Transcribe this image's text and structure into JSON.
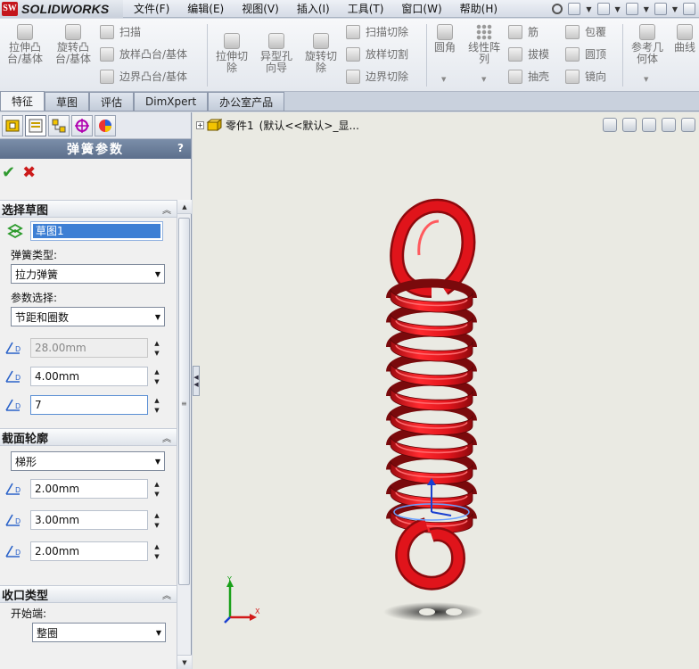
{
  "app": {
    "logo_mark": "SW",
    "logo_text": "SOLIDWORKS"
  },
  "menu": {
    "items": [
      "文件(F)",
      "编辑(E)",
      "视图(V)",
      "插入(I)",
      "工具(T)",
      "窗口(W)",
      "帮助(H)"
    ]
  },
  "command_manager": {
    "extrude_boss": "拉伸凸\n台/基体",
    "revolve_boss": "旋转凸\n台/基体",
    "sweep": "扫描",
    "loft_boss": "放样凸台/基体",
    "boundary_boss": "边界凸台/基体",
    "extrude_cut": "拉伸切\n除",
    "hole_wizard": "异型孔\n向导",
    "revolve_cut": "旋转切\n除",
    "swept_cut": "扫描切除",
    "lofted_cut": "放样切割",
    "boundary_cut": "边界切除",
    "fillet": "圆角",
    "linear_pattern": "线性阵\n列",
    "rib": "筋",
    "draft": "拔模",
    "shell": "抽壳",
    "wrap": "包覆",
    "dome": "圆顶",
    "mirror": "镜向",
    "ref_geometry": "参考几\n何体",
    "curves": "曲线"
  },
  "tabs": [
    "特征",
    "草图",
    "评估",
    "DimXpert",
    "办公室产品"
  ],
  "property_manager": {
    "title": "弹簧参数",
    "help": "?",
    "select_sketch": {
      "header": "选择草图",
      "sketch_value": "草图1",
      "spring_type_label": "弹簧类型:",
      "spring_type_value": "拉力弹簧",
      "param_label": "参数选择:",
      "param_value": "节距和圈数",
      "field1": "28.00mm",
      "field2": "4.00mm",
      "field3": "7"
    },
    "profile": {
      "header": "截面轮廓",
      "shape_value": "梯形",
      "field1": "2.00mm",
      "field2": "3.00mm",
      "field3": "2.00mm"
    },
    "end_type": {
      "header": "收口类型",
      "start_label": "开始端:",
      "start_value": "整圈"
    }
  },
  "graphics": {
    "tree_part": "零件1",
    "tree_config": "(默认<<默认>_显...",
    "axis_x": "X",
    "axis_y": "Y"
  },
  "colors": {
    "spring": "#e0141b",
    "spring_dark": "#7a0a0c",
    "viewport_bg": "#eaeae3",
    "pm_title_bg": "#6a7d98"
  }
}
